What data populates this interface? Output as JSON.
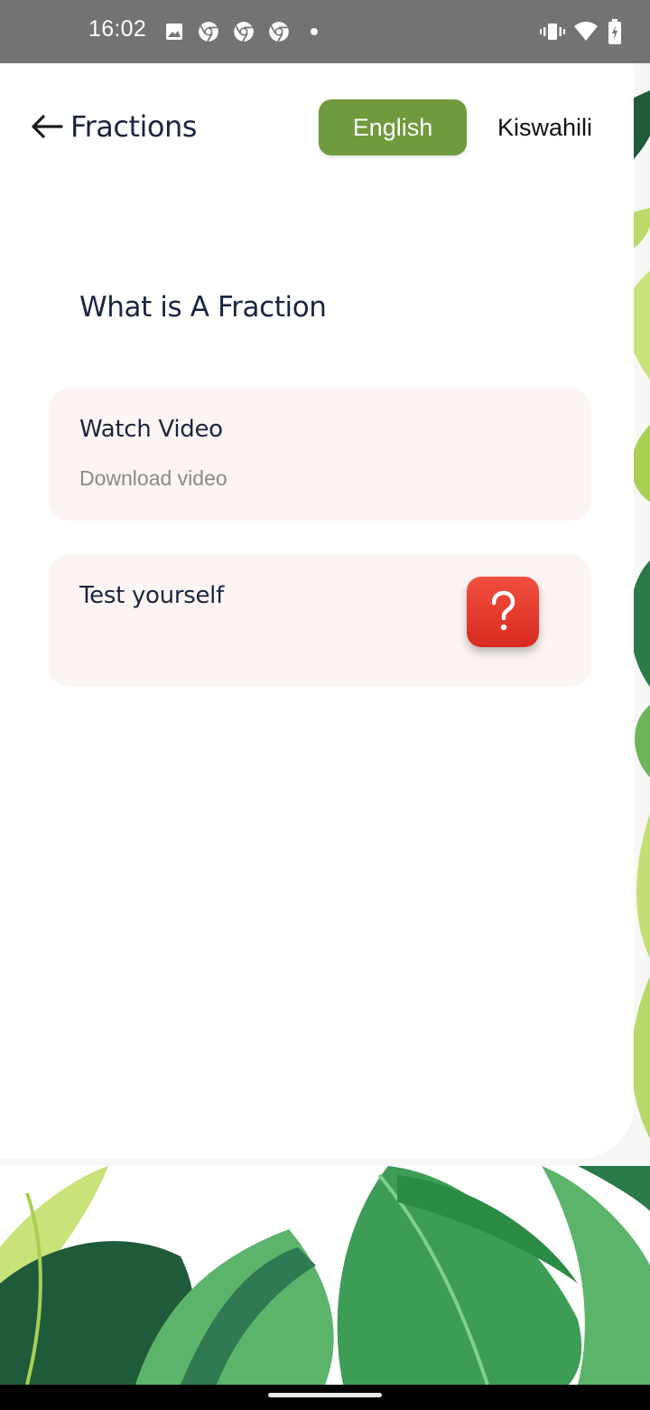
{
  "status_bar": {
    "time": "16:02",
    "icons": [
      "image-icon",
      "chrome-icon",
      "chrome-icon",
      "chrome-icon",
      "dot-icon",
      "vibrate-icon",
      "wifi-icon",
      "battery-icon"
    ]
  },
  "header": {
    "title": "Fractions",
    "languages": {
      "english": "English",
      "kiswahili": "Kiswahili",
      "selected": "English"
    }
  },
  "main": {
    "section_title": "What is A Fraction",
    "cards": {
      "video": {
        "title": "Watch Video",
        "subtitle": "Download video"
      },
      "test": {
        "title": "Test yourself",
        "icon": "question-icon"
      }
    }
  },
  "colors": {
    "accent_green": "#6f9a3d",
    "title_navy": "#1b2540",
    "card_bg": "#fcf5f3",
    "quiz_red": "#e03a2c"
  }
}
